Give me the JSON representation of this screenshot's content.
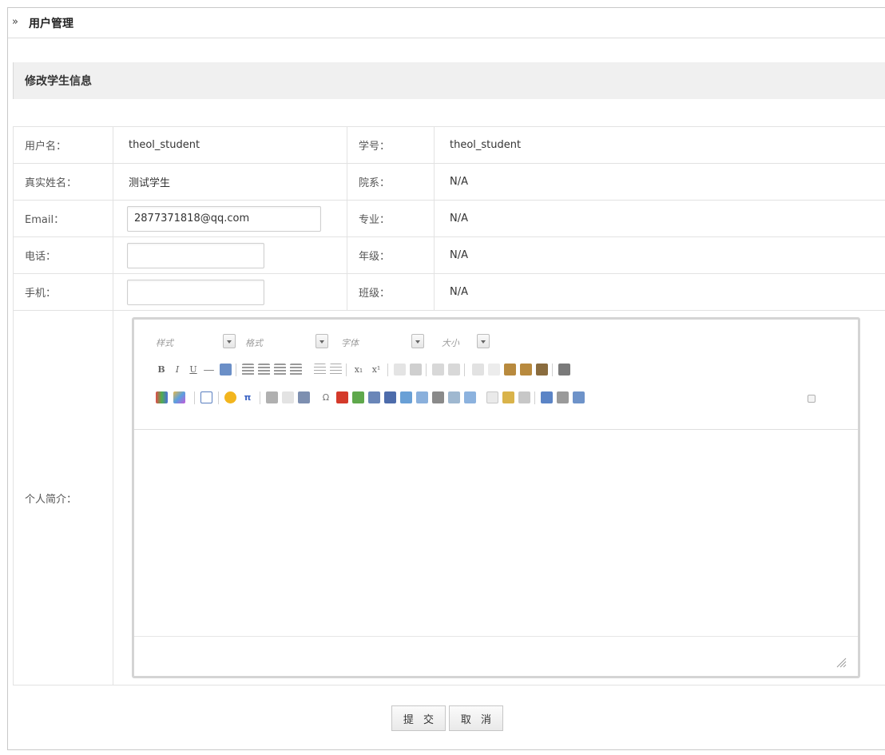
{
  "breadcrumb": {
    "arrow": "»",
    "title": "用户管理"
  },
  "section": {
    "title": "修改学生信息"
  },
  "form": {
    "username_label": "用户名：",
    "username_value": "theol_student",
    "student_id_label": "学号：",
    "student_id_value": "theol_student",
    "realname_label": "真实姓名：",
    "realname_value": "测试学生",
    "department_label": "院系：",
    "department_value": "N/A",
    "email_label": "Email：",
    "email_value": "2877371818@qq.com",
    "major_label": "专业：",
    "major_value": "N/A",
    "phone_label": "电话：",
    "phone_value": "",
    "grade_label": "年级：",
    "grade_value": "N/A",
    "mobile_label": "手机：",
    "mobile_value": "",
    "class_label": "班级：",
    "class_value": "N/A",
    "bio_label": "个人简介："
  },
  "editor": {
    "style_select": "样式",
    "format_select": "格式",
    "font_select": "字体",
    "size_select": "大小",
    "bold": "B",
    "italic": "I",
    "underline": "U",
    "subscript": "x₁",
    "superscript": "x¹",
    "pi": "π",
    "omega": "Ω"
  },
  "buttons": {
    "submit": "提 交",
    "cancel": "取 消"
  }
}
